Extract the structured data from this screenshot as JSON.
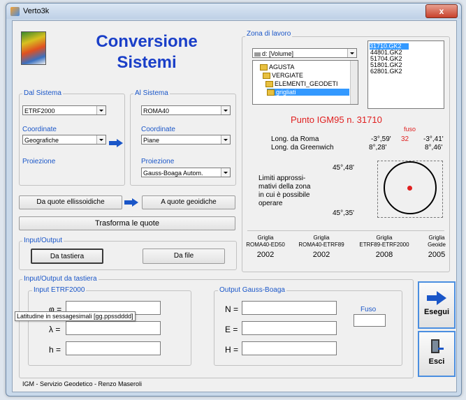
{
  "window": {
    "title": "Verto3k",
    "close_label": "x"
  },
  "header": {
    "title_line1": "Conversione",
    "title_line2": "Sistemi"
  },
  "dal_sistema": {
    "legend": "Dal Sistema",
    "system_value": "ETRF2000",
    "coord_label": "Coordinate",
    "coord_value": "Geografiche",
    "proj_label": "Proiezione"
  },
  "al_sistema": {
    "legend": "Al Sistema",
    "system_value": "ROMA40",
    "coord_label": "Coordinate",
    "coord_value": "Piane",
    "proj_label": "Proiezione",
    "proj_value": "Gauss-Boaga Autom."
  },
  "quote": {
    "from_label": "Da quote ellissoidiche",
    "to_label": "A quote geoidiche",
    "transform_label": "Trasforma le quote"
  },
  "io": {
    "legend": "Input/Output",
    "keyboard_label": "Da tastiera",
    "file_label": "Da file"
  },
  "zona": {
    "legend": "Zona di lavoro",
    "drive_value": "d: [Volume]",
    "folders": [
      "AGUSTA",
      "VERGIATE",
      "ELEMENTI_GEODETI",
      "grigliati"
    ],
    "files": [
      "31710.GK2",
      "44801.GK2",
      "51704.GK2",
      "51801.GK2",
      "62801.GK2"
    ],
    "punto_label": "Punto IGM95 n.  31710",
    "fuso_label": "fuso",
    "long_roma_label": "Long. da Roma",
    "long_roma_1": "-3°,59'",
    "fuso_value": "32",
    "long_roma_2": "-3°,41'",
    "long_green_label": "Long. da Greenwich",
    "long_green_1": "8°,28'",
    "long_green_2": "8°,46'",
    "lat_top": "45°,48'",
    "lat_bottom": "45°,35'",
    "limiti_l1": "Limiti approssi-",
    "limiti_l2": "mativi della zona",
    "limiti_l3": "in cui è possibile",
    "limiti_l4": "operare"
  },
  "griglie": [
    {
      "title": "Griglia",
      "sub": "ROMA40-ED50",
      "year": "2002"
    },
    {
      "title": "Griglia",
      "sub": "ROMA40-ETRF89",
      "year": "2002"
    },
    {
      "title": "Griglia",
      "sub": "ETRF89-ETRF2000",
      "year": "2008"
    },
    {
      "title": "Griglia",
      "sub": "Geoide",
      "year": "2005"
    }
  ],
  "tastiera": {
    "legend": "Input/Output da tastiera",
    "input_legend": "Input ETRF2000",
    "phi": "φ =",
    "lambda": "λ =",
    "h": "h =",
    "output_legend": "Output Gauss-Boaga",
    "N": "N =",
    "E": "E =",
    "H": "H =",
    "fuso_label": "Fuso",
    "tooltip": "Latitudine in sessagesimali [gg.ppssdddd]"
  },
  "actions": {
    "esegui_label": "Esegui",
    "esci_label": "Esci"
  },
  "footer": {
    "credit": "IGM - Servizio Geodetico - Renzo Maseroli"
  },
  "colors": {
    "accent": "#1a56c8",
    "highlight_red": "#e02020",
    "selection": "#3399ff"
  }
}
